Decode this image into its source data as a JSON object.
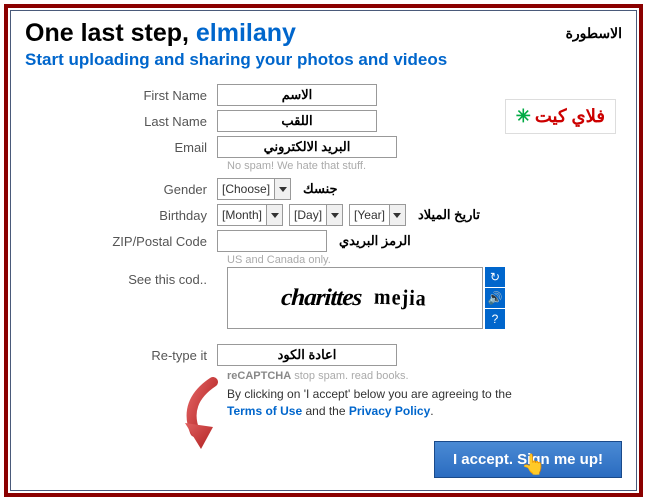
{
  "title": {
    "prefix": "One last step, ",
    "username": "elmilany"
  },
  "ar_top": "الاسطورة",
  "subtitle": "Start uploading and sharing your photos and videos",
  "logo": {
    "text": "فلاي كيت",
    "star": "✳"
  },
  "fields": {
    "firstName": {
      "label": "First Name",
      "value": "الاسم"
    },
    "lastName": {
      "label": "Last Name",
      "value": "اللقب"
    },
    "email": {
      "label": "Email",
      "value": "البريد الالكتروني",
      "hint": "No spam! We hate that stuff."
    },
    "gender": {
      "label": "Gender",
      "selected": "[Choose]",
      "ar": "جنسك"
    },
    "birthday": {
      "label": "Birthday",
      "month": "[Month]",
      "day": "[Day]",
      "year": "[Year]",
      "ar": "تاريخ الميلاد"
    },
    "zip": {
      "label": "ZIP/Postal Code",
      "value": "",
      "ar": "الرمز البريدي",
      "hint": "US and Canada only."
    },
    "captcha": {
      "label": "See this cod..",
      "word1": "charittes",
      "word2": "mejia"
    },
    "retype": {
      "label": "Re-type it",
      "value": "اعادة الكود",
      "hint_bold": "reCAPTCHA",
      "hint_rest": " stop spam. read books."
    }
  },
  "captcha_buttons": {
    "refresh": "↻",
    "audio": "🔊",
    "help": "?"
  },
  "agree": {
    "text1": "By clicking on 'I accept' below you are agreeing to the ",
    "terms": "Terms of Use",
    "and": " and the ",
    "privacy": "Privacy Policy",
    "dot": "."
  },
  "accept": "I accept. Sign me up!"
}
